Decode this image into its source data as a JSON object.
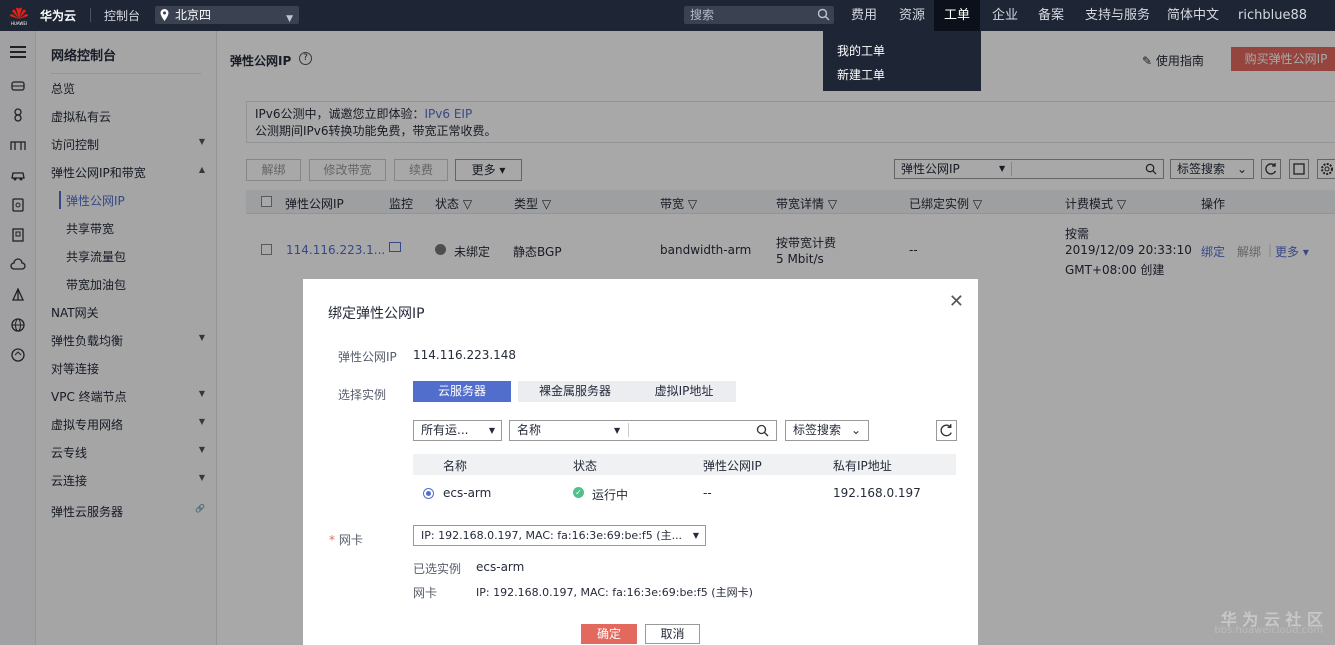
{
  "topbar": {
    "brand_sub": "HUAWEI",
    "brand": "华为云",
    "console": "控制台",
    "region": "北京四",
    "search_placeholder": "搜索",
    "nav": [
      "费用",
      "资源",
      "工单",
      "企业",
      "备案",
      "支持与服务",
      "简体中文",
      "richblue88"
    ],
    "active_nav": "工单",
    "dropdown": [
      "我的工单",
      "新建工单"
    ]
  },
  "sidebar": {
    "title": "网络控制台",
    "items": [
      "总览",
      "虚拟私有云",
      "访问控制",
      "弹性公网IP和带宽"
    ],
    "subitems": [
      "弹性公网IP",
      "共享带宽",
      "共享流量包",
      "带宽加油包"
    ],
    "items2": [
      "NAT网关",
      "弹性负载均衡",
      "对等连接",
      "VPC 终端节点",
      "虚拟专用网络",
      "云专线",
      "云连接",
      "弹性云服务器"
    ]
  },
  "main": {
    "title": "弹性公网IP",
    "help": "?",
    "guide": "使用指南",
    "buy_button": "购买弹性公网IP",
    "notice_line1": "IPv6公测中，诚邀您立即体验：",
    "notice_link": "IPv6 EIP",
    "notice_line2": "公测期间IPv6转换功能免费，带宽正常收费。",
    "toolbar": [
      "解绑",
      "修改带宽",
      "续费",
      "更多"
    ],
    "filter_select": "弹性公网IP",
    "tag_search": "标签搜索",
    "columns": [
      "弹性公网IP",
      "监控",
      "状态",
      "类型",
      "带宽",
      "带宽详情",
      "已绑定实例",
      "计费模式",
      "操作"
    ],
    "row": {
      "ip": "114.116.223.1...",
      "status": "未绑定",
      "type": "静态BGP",
      "bandwidth": "bandwidth-arm",
      "bw_detail1": "按带宽计费",
      "bw_detail2": "5 Mbit/s",
      "instance": "--",
      "billing1": "按需",
      "billing2": "2019/12/09 20:33:10",
      "billing3": "GMT+08:00 创建",
      "op_bind": "绑定",
      "op_unbind": "解绑",
      "op_more": "更多"
    }
  },
  "modal": {
    "title": "绑定弹性公网IP",
    "eip_label": "弹性公网IP",
    "eip_value": "114.116.223.148",
    "instance_label": "选择实例",
    "tabs": [
      "云服务器",
      "裸金属服务器",
      "虚拟IP地址"
    ],
    "filter_project": "所有运...",
    "filter_field": "名称",
    "tag_search": "标签搜索",
    "columns": [
      "名称",
      "状态",
      "弹性公网IP",
      "私有IP地址"
    ],
    "row": {
      "name": "ecs-arm",
      "status": "运行中",
      "eip": "--",
      "private_ip": "192.168.0.197"
    },
    "nic_label": "网卡",
    "nic_value": "IP: 192.168.0.197, MAC: fa:16:3e:69:be:f5 (主...",
    "selected_label": "已选实例",
    "selected_value": "ecs-arm",
    "nic_label2": "网卡",
    "nic_value2": "IP: 192.168.0.197, MAC: fa:16:3e:69:be:f5 (主网卡)",
    "ok": "确定",
    "cancel": "取消"
  },
  "watermark": {
    "cn": "华 为 云 社 区",
    "url": "bbs.huaweicloud.com"
  },
  "colors": {
    "accent": "#526ecc",
    "primary_button": "#e3695f",
    "topbar": "#1e2534"
  }
}
